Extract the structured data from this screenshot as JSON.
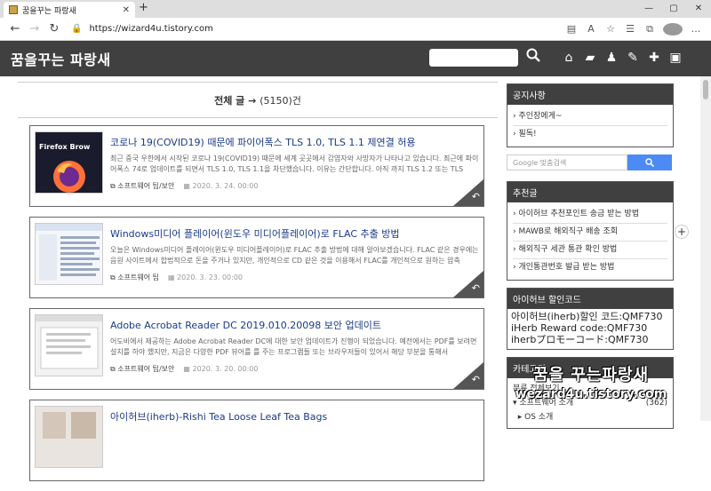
{
  "browser": {
    "tab_title": "꿈을꾸는 파랑새",
    "url": "https://wizard4u.tistory.com"
  },
  "blog": {
    "title": "꿈을꾸는 파랑새",
    "count_label": "전체 글 →",
    "count_value": "(5150)건"
  },
  "posts": [
    {
      "title": "코로나 19(COVID19) 때문에 파이어폭스 TLS 1.0, TLS 1.1 제연결 허용",
      "desc": "최근 중국 우한에서 시작된 코로나 19(COVID19) 때문에 세계 곳곳에서 감염자와 사망자가 나타나고 있습니다. 최근에 파이어폭스 74로 업데이트를 되면서 TLS 1.0, TLS 1.1을 차단했습니다. 이유는 간단합니다. 아직 까지 TLS 1.2 또는 TLS",
      "category": "소프트웨어 팁/보안",
      "date": "2020. 3. 24. 00:00",
      "thumb_text": "Firefox Brow"
    },
    {
      "title": "Windows미디어 플레이어(윈도우 미디어플레이어)로 FLAC 추출 방법",
      "desc": "오늘은 Windows미디어 플레이어(윈도우 미디어플레이어)로 FLAC 추출 방법에 대해 알아보겠습니다. FLAC 같은 경우에는 음원 사이트에서 합법적으로 돈을 주거나 있지만, 개인적으로 CD 같은 것을 이용해서 FLAC를 개인적으로 원하는 압축",
      "category": "소프트웨어 팁",
      "date": "2020. 3. 23. 00:00",
      "thumb_text": ""
    },
    {
      "title": "Adobe Acrobat Reader DC 2019.010.20098 보안 업데이트",
      "desc": "어도비에서 제공하는 Adobe Acrobat Reader DC에 대한 보안 업데이트가 진행이 되었습니다. 예전에서는 PDF를 보려면 설치를 하야 했지만, 지금은 다양한 PDF 뷰어를 를 주는 프로그램들 또는 브라우저들이 있어서 해당 부분을 통해서",
      "category": "소프트웨어 팁/보안",
      "date": "2020. 3. 20. 00:00",
      "thumb_text": ""
    },
    {
      "title": "아이허브(iherb)-Rishi Tea Loose Leaf Tea Bags",
      "desc": "",
      "category": "",
      "date": "",
      "thumb_text": ""
    }
  ],
  "sidebar": {
    "notice_title": "공지사항",
    "notice_items": [
      "주인장에게~",
      "필독!"
    ],
    "gsearch_placeholder": "Google 맞춤검색",
    "gsearch_button": "검색",
    "recommend_title": "추천글",
    "recommend_items": [
      "아이허브 추천포인트 송금 받는 방법",
      "MAWB로 해외직구 배송 조회",
      "해외직구 세관 통관 확인 방법",
      "개인통관번호 발급 받는 방법"
    ],
    "iherb_title": "아이허브 할인코드",
    "iherb_lines": [
      "아이허브(iherb)할인 코드:QMF730",
      "iHerb Reward code:QMF730",
      "iherbプロモーコード:QMF730"
    ],
    "category_title": "카테고리",
    "category_lines": [
      {
        "label": "분류 전체보기",
        "count": ""
      },
      {
        "label": "소프트웨어 소개",
        "count": "(362)"
      },
      {
        "label": "OS 소개",
        "count": ""
      }
    ]
  },
  "watermark": {
    "line1": "꿈을 꾸는파랑새",
    "line2": "wezard4u.tistory.com"
  }
}
